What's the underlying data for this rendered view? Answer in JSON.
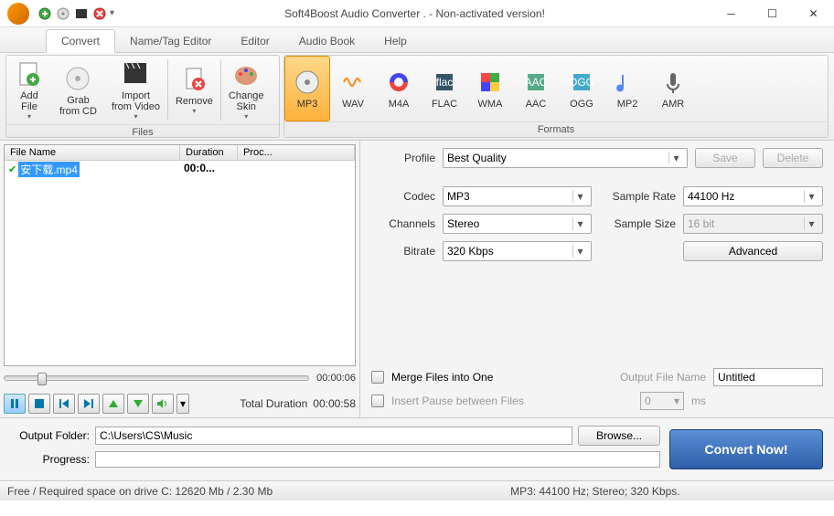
{
  "window": {
    "title": "Soft4Boost Audio Converter  . - Non-activated version!"
  },
  "tabs": {
    "convert": "Convert",
    "name_tag": "Name/Tag Editor",
    "editor": "Editor",
    "audio_book": "Audio Book",
    "help": "Help"
  },
  "ribbon": {
    "files_group": "Files",
    "formats_group": "Formats",
    "add_file": "Add\nFile",
    "grab_cd": "Grab\nfrom CD",
    "import_video": "Import\nfrom Video",
    "remove": "Remove",
    "change_skin": "Change\nSkin",
    "formats": [
      "MP3",
      "WAV",
      "M4A",
      "FLAC",
      "WMA",
      "AAC",
      "OGG",
      "MP2",
      "AMR"
    ]
  },
  "filelist": {
    "headers": {
      "name": "File Name",
      "duration": "Duration",
      "process": "Proc..."
    },
    "rows": [
      {
        "name": "安下载.mp4",
        "duration": "00:0...",
        "process": ""
      }
    ]
  },
  "player": {
    "position": "00:00:06",
    "total_label": "Total Duration",
    "total": "00:00:58"
  },
  "profile": {
    "label": "Profile",
    "value": "Best Quality",
    "save": "Save",
    "delete": "Delete"
  },
  "codec": {
    "label": "Codec",
    "value": "MP3"
  },
  "channels": {
    "label": "Channels",
    "value": "Stereo"
  },
  "bitrate": {
    "label": "Bitrate",
    "value": "320 Kbps"
  },
  "samplerate": {
    "label": "Sample Rate",
    "value": "44100 Hz"
  },
  "samplesize": {
    "label": "Sample Size",
    "value": "16 bit"
  },
  "advanced": "Advanced",
  "merge": {
    "label": "Merge Files into One"
  },
  "pause": {
    "label": "Insert Pause between Files",
    "value": "0",
    "unit": "ms"
  },
  "outputname": {
    "label": "Output File Name",
    "value": "Untitled"
  },
  "output": {
    "folder_label": "Output Folder:",
    "folder": "C:\\Users\\CS\\Music",
    "browse": "Browse...",
    "progress_label": "Progress:",
    "convert": "Convert Now!"
  },
  "status": {
    "left": "Free / Required space on drive  C: 12620 Mb / 2.30 Mb",
    "right": "MP3: 44100  Hz; Stereo; 320 Kbps."
  }
}
